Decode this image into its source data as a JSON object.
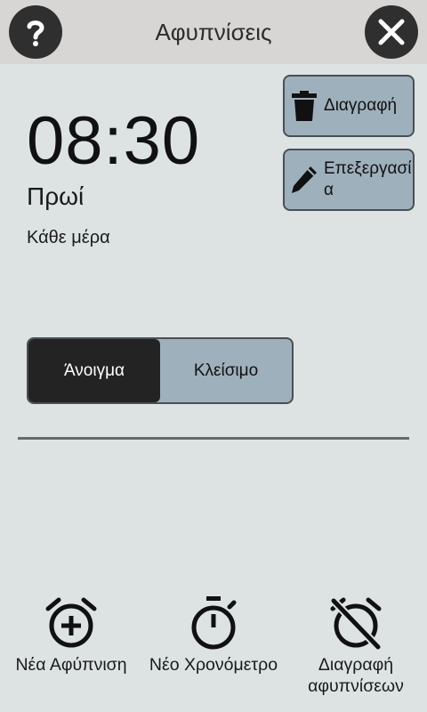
{
  "header": {
    "title": "Αφυπνίσεις",
    "help_icon": "help-icon",
    "close_icon": "close-icon"
  },
  "alarm": {
    "time": "08:30",
    "period": "Πρωί",
    "repeat": "Κάθε μέρα"
  },
  "actions": {
    "delete_label": "Διαγραφή",
    "edit_label": "Επεξεργασία"
  },
  "toggle": {
    "on_label": "Άνοιγμα",
    "off_label": "Κλείσιμο",
    "selected": "on"
  },
  "bottom": {
    "new_alarm_label": "Νέα Αφύπνιση",
    "new_timer_label": "Νέο Χρονόμετρο",
    "delete_alarms_label": "Διαγραφή αφυπνίσεων"
  },
  "colors": {
    "background": "#dde3e3",
    "header": "#d8d6d4",
    "button": "#9fb0bd",
    "dark": "#232323"
  }
}
